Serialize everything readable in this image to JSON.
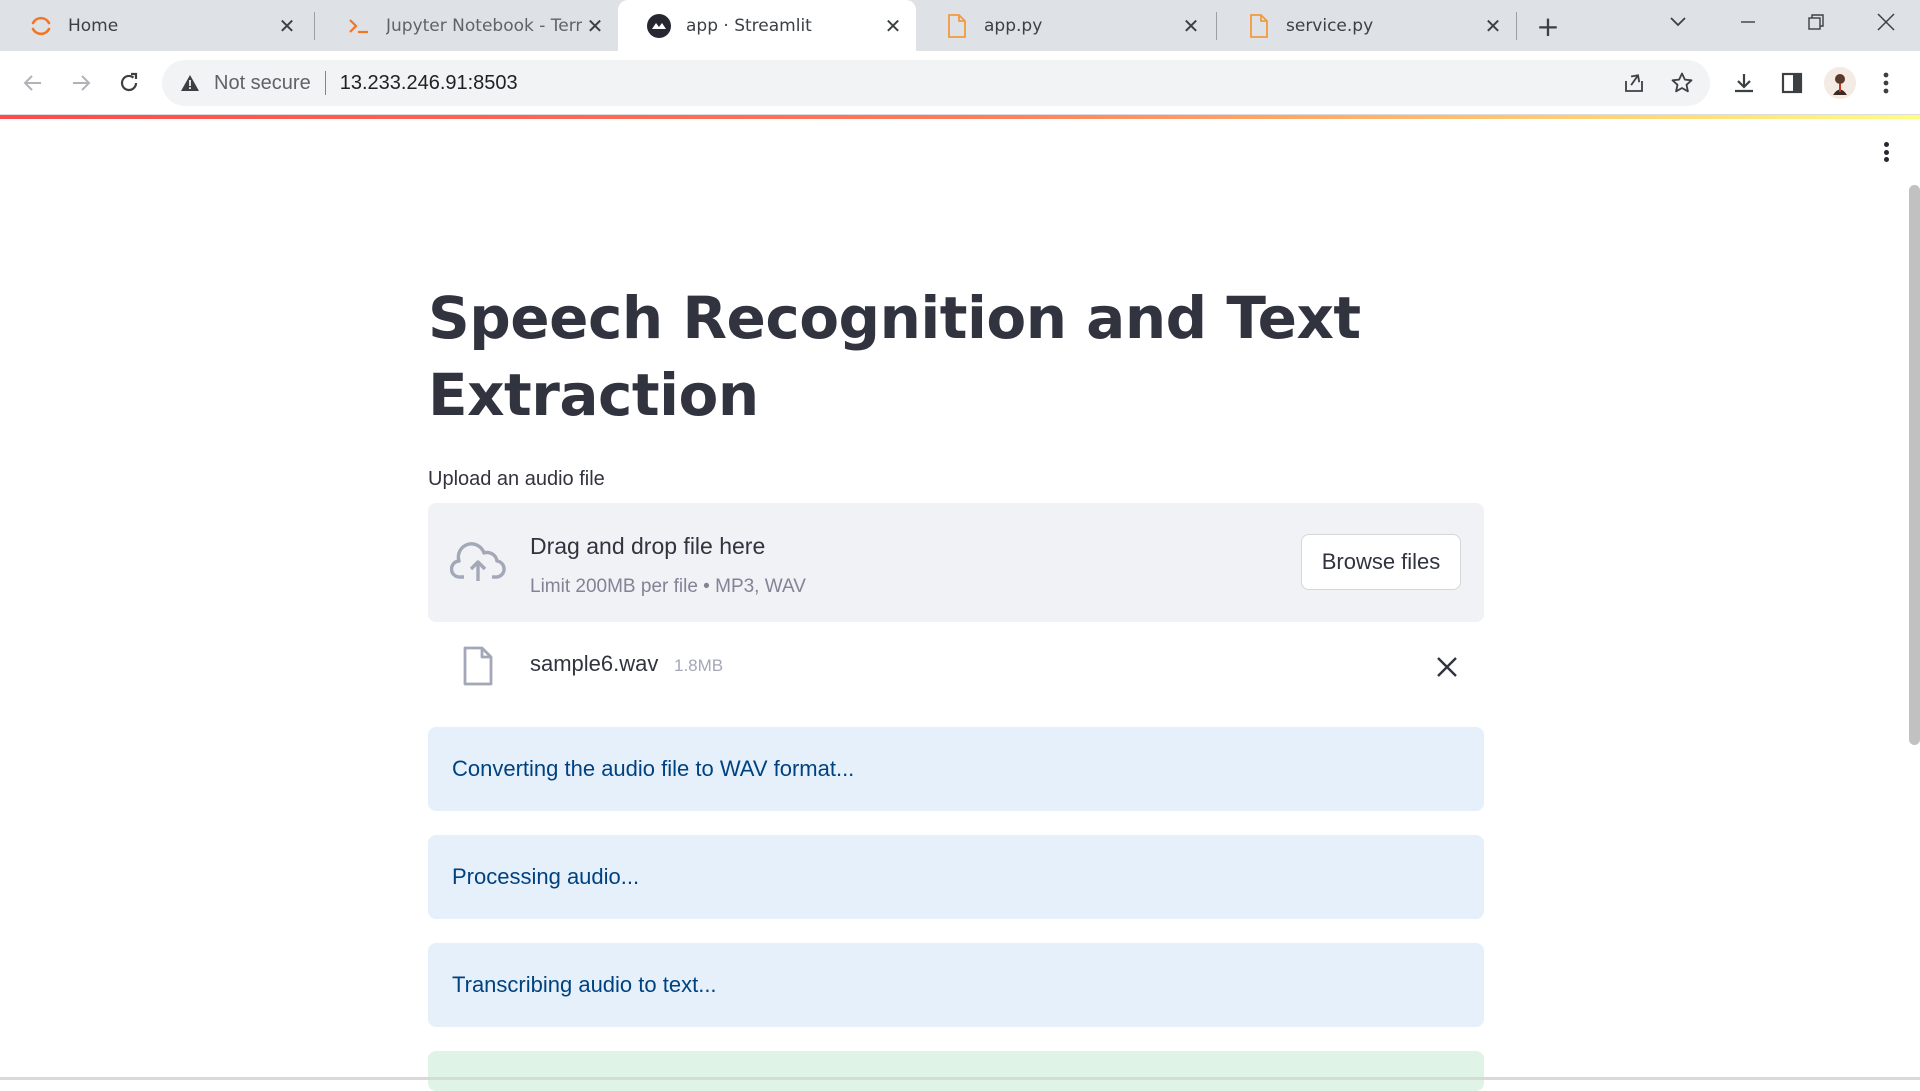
{
  "browser": {
    "tabs": [
      {
        "title": "Home",
        "icon": "jupyter-icon",
        "active": false
      },
      {
        "title": "Jupyter Notebook - Terminal",
        "icon": "terminal-icon",
        "active": false
      },
      {
        "title": "app · Streamlit",
        "icon": "streamlit-icon",
        "active": true
      },
      {
        "title": "app.py",
        "icon": "file-icon",
        "active": false
      },
      {
        "title": "service.py",
        "icon": "file-icon",
        "active": false
      }
    ],
    "security_label": "Not secure",
    "url": "13.233.246.91:8503"
  },
  "app": {
    "title": "Speech Recognition and Text Extraction",
    "uploader": {
      "label": "Upload an audio file",
      "drag_text": "Drag and drop file here",
      "limit_text": "Limit 200MB per file • MP3, WAV",
      "browse_label": "Browse files"
    },
    "uploaded_file": {
      "name": "sample6.wav",
      "size": "1.8MB"
    },
    "status_messages": [
      "Converting the audio file to WAV format...",
      "Processing audio...",
      "Transcribing audio to text..."
    ]
  },
  "colors": {
    "info_background": "#e6f0fb",
    "info_text": "#004280",
    "success_background": "#dff3e6",
    "title_text": "#31333f"
  }
}
